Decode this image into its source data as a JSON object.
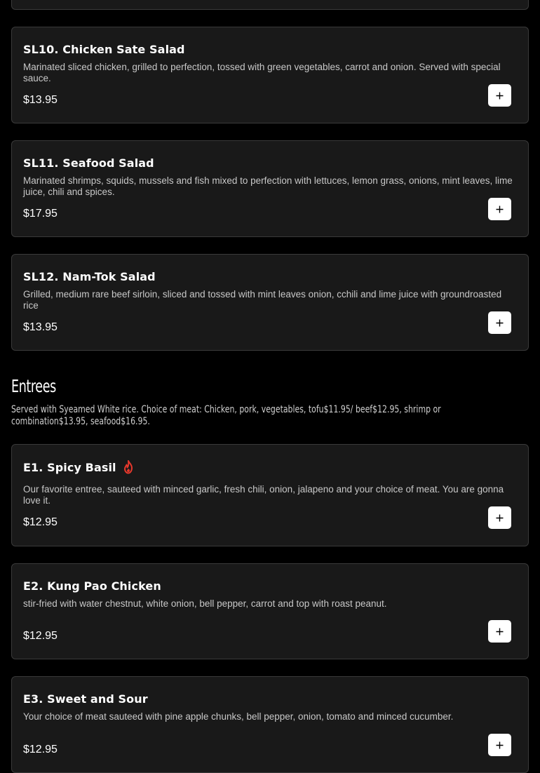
{
  "salads": [
    {
      "title": "SL10. Chicken Sate Salad",
      "description": "Marinated sliced chicken, grilled to perfection, tossed with green vegetables, carrot and onion. Served with special sauce.",
      "price": "$13.95"
    },
    {
      "title": "SL11. Seafood Salad",
      "description": "Marinated shrimps, squids, mussels and fish mixed to perfection with lettuces, lemon grass, onions, mint leaves, lime juice, chili and spices.",
      "price": "$17.95"
    },
    {
      "title": "SL12. Nam-Tok Salad",
      "description": "Grilled, medium rare beef sirloin, sliced and tossed with mint leaves onion, cchili and lime juice with groundroasted rice",
      "price": "$13.95"
    }
  ],
  "entrees": {
    "heading": "Entrees",
    "subheading": "Served with Syeamed White rice. Choice of meat: Chicken, pork, vegetables, tofu$11.95/ beef$12.95, shrimp or combination$13.95, seafood$16.95.",
    "items": [
      {
        "title": "E1. Spicy Basil",
        "description": "Our favorite entree, sauteed with minced garlic, fresh chili, onion, jalapeno and your choice of meat. You are gonna love it.",
        "price": "$12.95",
        "icon": "flame-icon",
        "icon_color": "#e8382c"
      },
      {
        "title": "E2. Kung Pao Chicken",
        "description": "stir-fried with water chestnut, white onion, bell pepper, carrot and top with roast peanut.",
        "price": "$12.95"
      },
      {
        "title": "E3. Sweet and Sour",
        "description": "Your choice of meat sauteed with pine apple chunks, bell pepper, onion, tomato and minced cucumber.",
        "price": "$12.95"
      }
    ]
  },
  "colors": {
    "background": "#000000",
    "card": "#191919",
    "card_border": "#3a3a3a",
    "button": "#ffffff"
  }
}
